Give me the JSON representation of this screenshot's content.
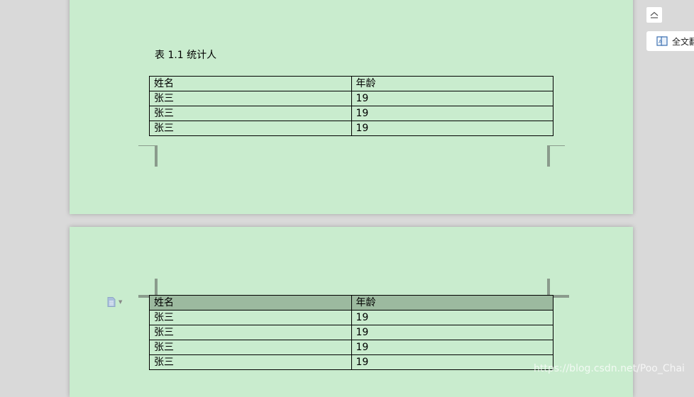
{
  "page1": {
    "caption": "表 1.1  统计人",
    "table": {
      "header": [
        "姓名",
        "年龄"
      ],
      "rows": [
        [
          "张三",
          "19"
        ],
        [
          "张三",
          "19"
        ],
        [
          "张三",
          "19"
        ]
      ]
    }
  },
  "page2": {
    "table": {
      "header": [
        "姓名",
        "年龄"
      ],
      "rows": [
        [
          "张三",
          "19"
        ],
        [
          "张三",
          "19"
        ],
        [
          "张三",
          "19"
        ],
        [
          "张三",
          "19"
        ]
      ]
    }
  },
  "sidebar": {
    "collapse_icon": "collapse-up-icon",
    "fulltext_label": "全文翻译"
  },
  "watermark": "https://blog.csdn.net/Poo_Chai",
  "colors": {
    "page_background": "#c9ecce",
    "header_highlight": "#9cba9f",
    "workspace": "#d9d9d9"
  }
}
